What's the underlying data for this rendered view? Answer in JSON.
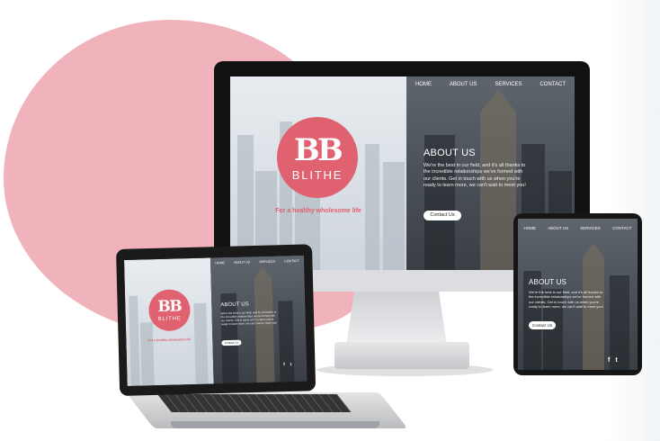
{
  "brand": {
    "mark": "BB",
    "name": "BLITHE",
    "tagline": "For a healthy wholesome life",
    "accent": "#e0616f",
    "blob_color": "#f0b3bb"
  },
  "nav": {
    "items": [
      "HOME",
      "ABOUT US",
      "SERVICES",
      "CONTACT"
    ]
  },
  "about": {
    "heading": "ABOUT US",
    "body": "We're the best in our field, and it's all thanks to the incredible relationships we've formed with our clients. Get in touch with us when you're ready to learn more, we can't wait to meet you!",
    "button": "Contact Us"
  },
  "social": {
    "icons": [
      "facebook-icon",
      "twitter-icon"
    ],
    "facebook": "f",
    "twitter": "t"
  }
}
